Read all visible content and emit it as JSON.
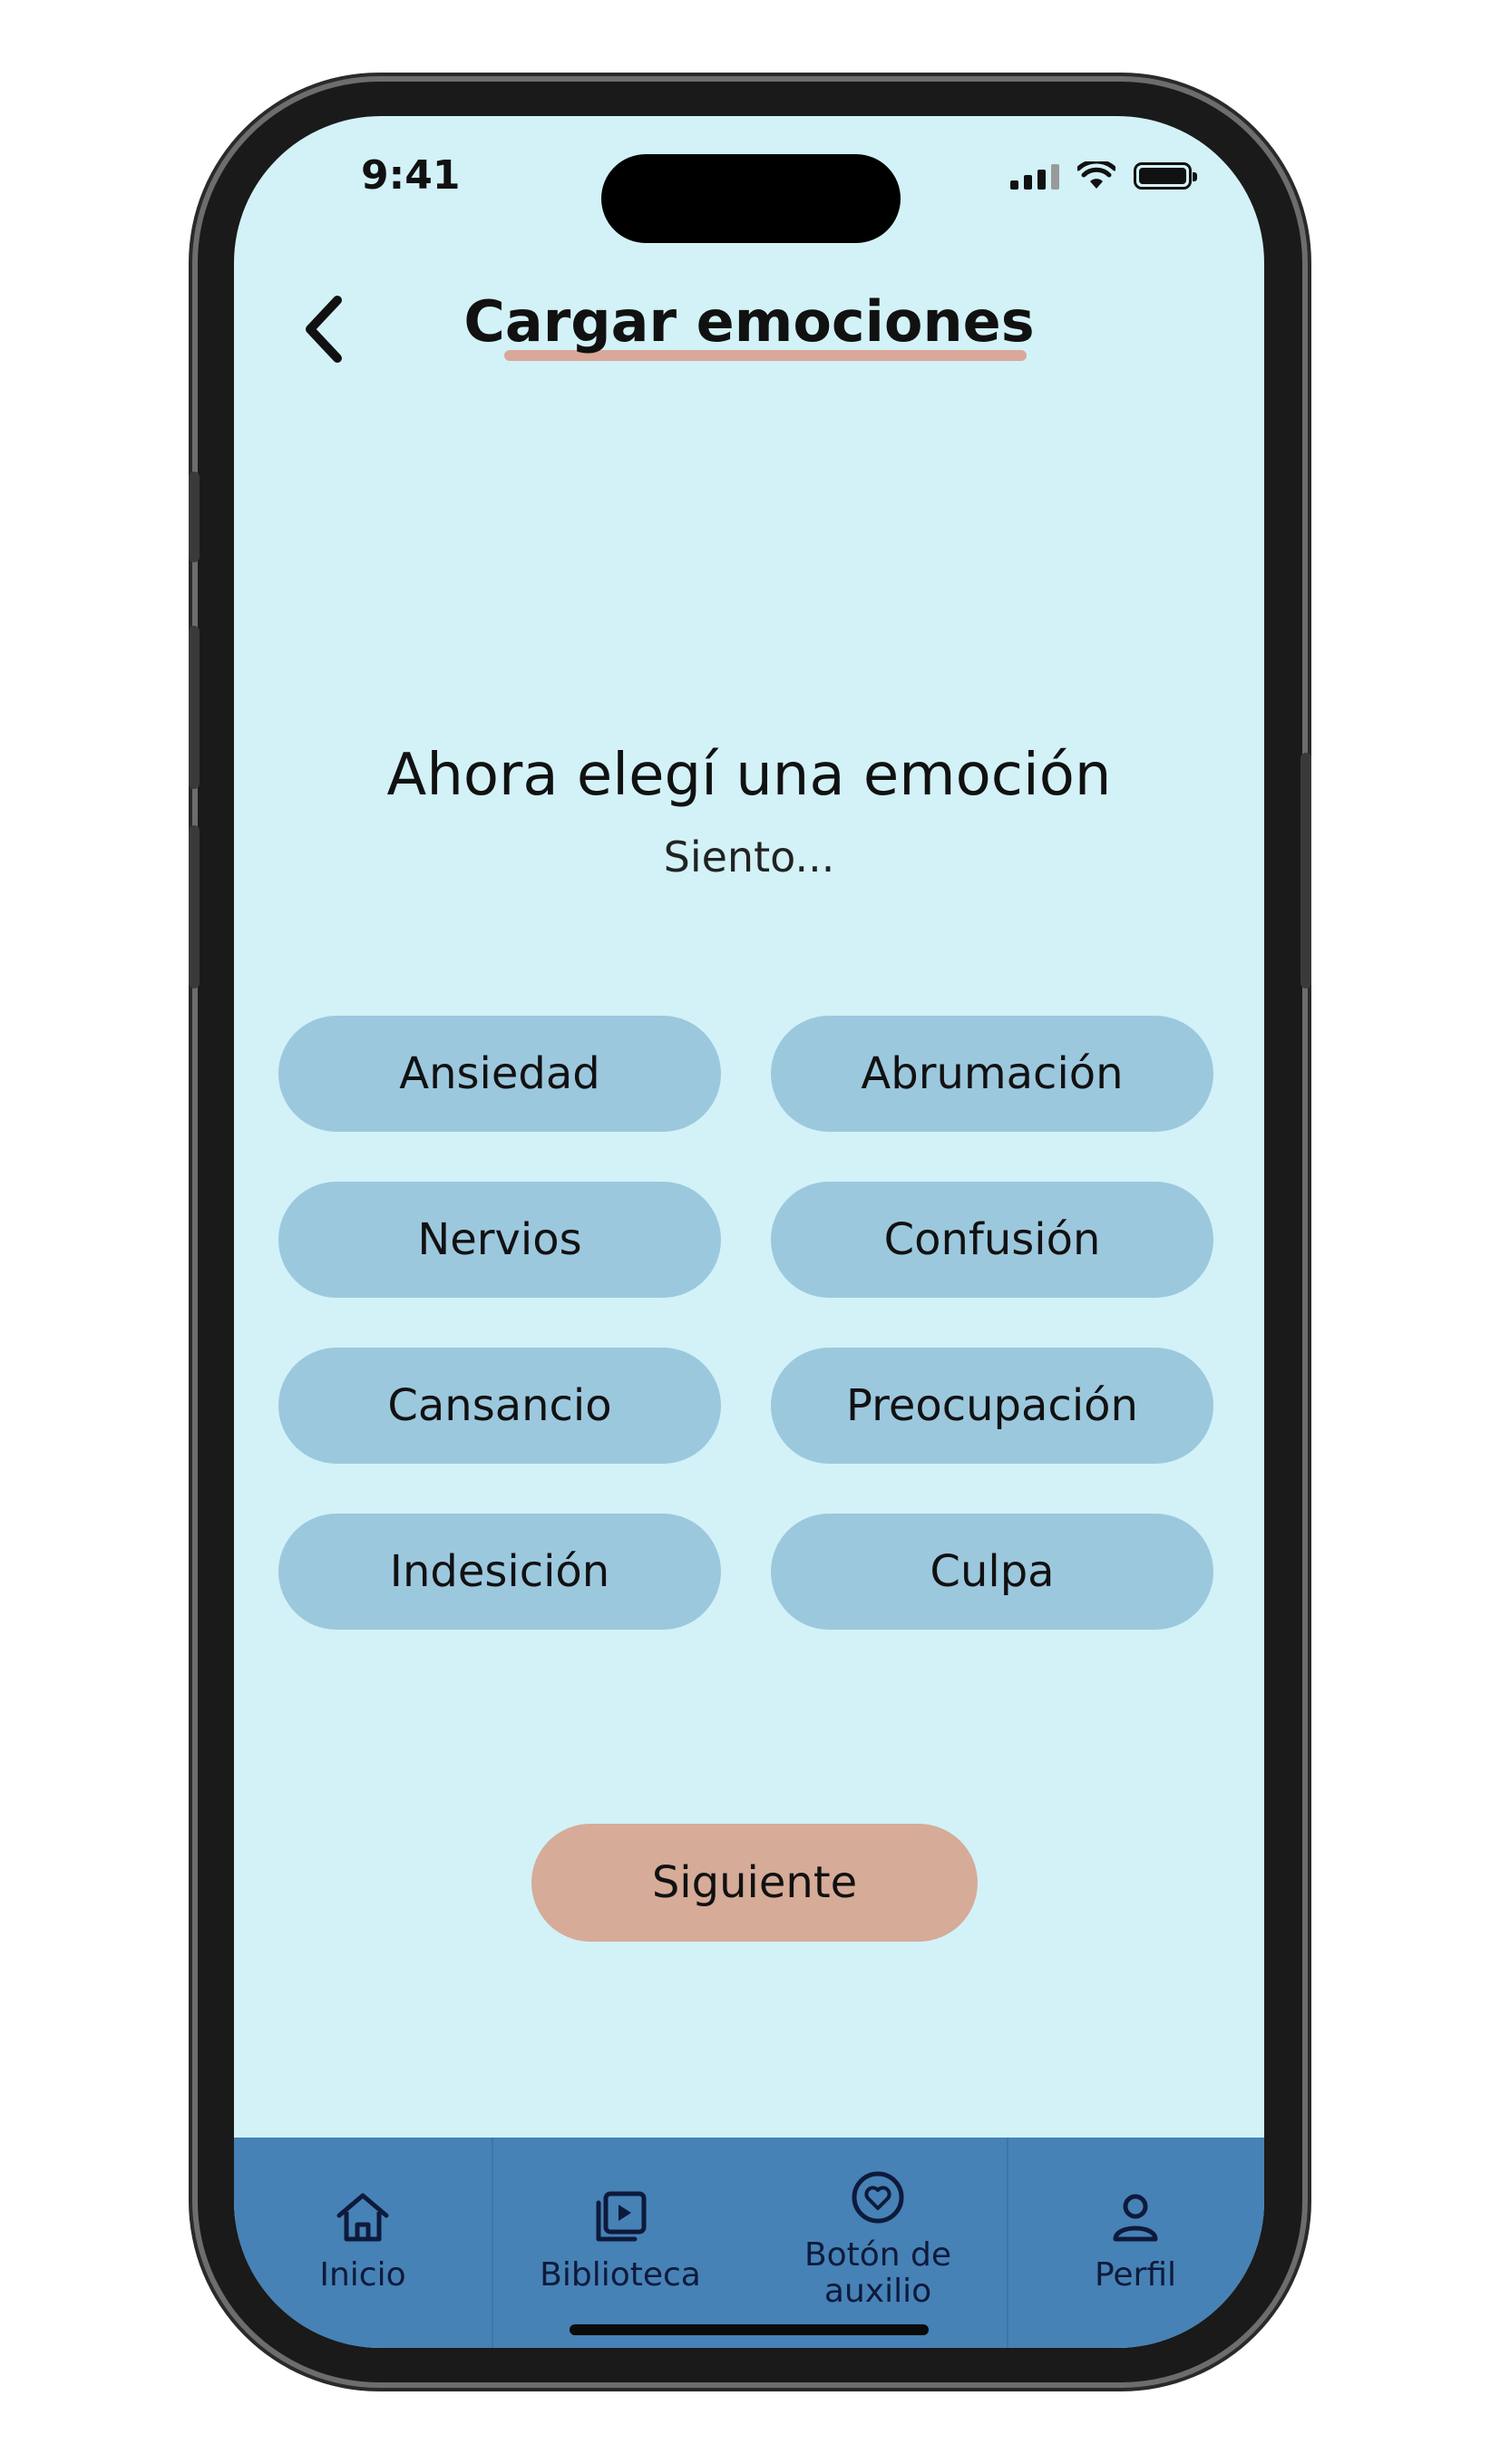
{
  "status_bar": {
    "time": "9:41"
  },
  "header": {
    "title": "Cargar emociones",
    "back_icon": "chevron-left-icon"
  },
  "prompt": {
    "heading": "Ahora elegí una emoción",
    "subheading": "Siento..."
  },
  "emotions": [
    {
      "label": "Ansiedad"
    },
    {
      "label": "Abrumación"
    },
    {
      "label": "Nervios"
    },
    {
      "label": "Confusión"
    },
    {
      "label": "Cansancio"
    },
    {
      "label": "Preocupación"
    },
    {
      "label": "Indesición"
    },
    {
      "label": "Culpa"
    }
  ],
  "next_button": {
    "label": "Siguiente"
  },
  "tabbar": {
    "items": [
      {
        "label": "Inicio",
        "icon": "home-icon"
      },
      {
        "label": "Biblioteca",
        "icon": "library-icon"
      },
      {
        "label": "Botón de\nauxilio",
        "line1": "Botón de",
        "line2": "auxilio",
        "icon": "heart-circle-icon"
      },
      {
        "label": "Perfil",
        "icon": "user-icon"
      }
    ]
  },
  "colors": {
    "background": "#d2f2f7",
    "emotion_chip": "#9cc8de",
    "accent": "#d6ab98",
    "tabbar": "#4682b6"
  }
}
